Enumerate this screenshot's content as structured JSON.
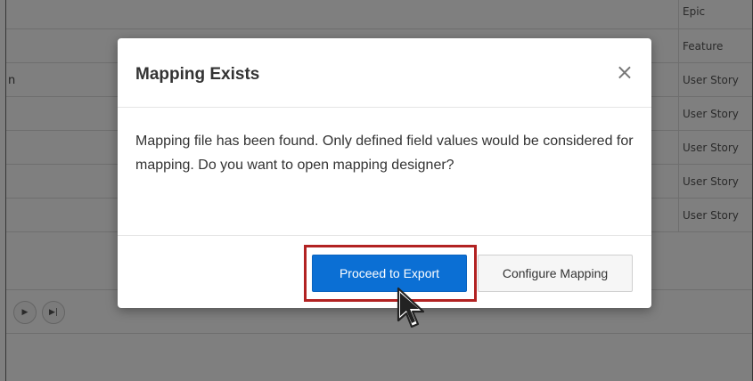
{
  "background_table": {
    "rows": [
      {
        "type": "Epic",
        "left_fragment": ""
      },
      {
        "type": "Feature",
        "left_fragment": ""
      },
      {
        "type": "User Story",
        "left_fragment": "n"
      },
      {
        "type": "User Story",
        "left_fragment": ""
      },
      {
        "type": "User Story",
        "left_fragment": ""
      },
      {
        "type": "User Story",
        "left_fragment": ""
      },
      {
        "type": "User Story",
        "left_fragment": ""
      }
    ],
    "pager": {
      "next_icon": "play-icon",
      "last_icon": "skip-to-end-icon",
      "next_glyph": "▶",
      "last_glyph": "▶|"
    }
  },
  "dialog": {
    "title": "Mapping Exists",
    "close_glyph": "×",
    "body": "Mapping file has been found. Only defined field values would be considered for mapping. Do you want to open mapping designer?",
    "primary_button": "Proceed to Export",
    "secondary_button": "Configure Mapping"
  },
  "colors": {
    "primary": "#0b6fd4",
    "highlight": "#b22222"
  }
}
